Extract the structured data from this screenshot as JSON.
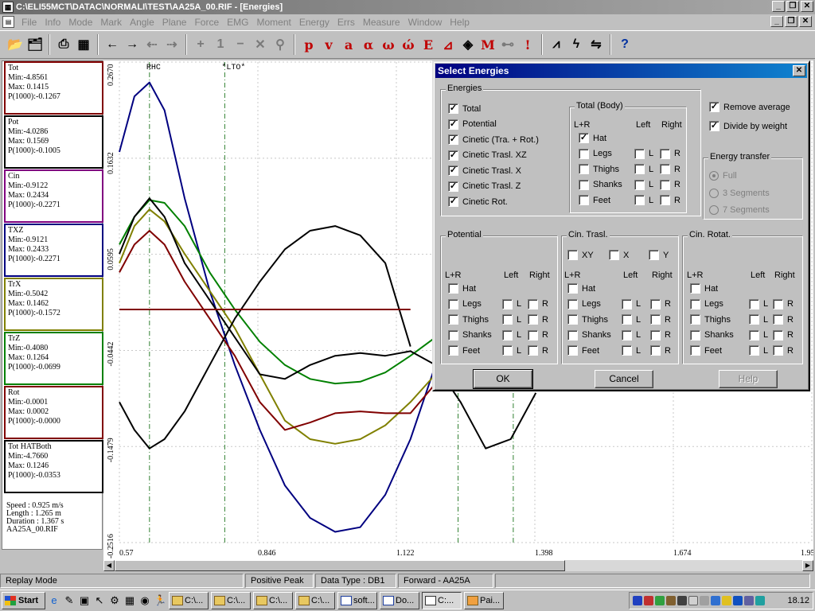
{
  "window": {
    "title": "C:\\ELI55MCT\\DATAC\\NORMALI\\TEST\\AA25A_00.RIF - [Energies]",
    "app_icon": "vicon-app-icon"
  },
  "menubar": {
    "items": [
      "File",
      "Info",
      "Mode",
      "Mark",
      "Angle",
      "Plane",
      "Force",
      "EMG",
      "Moment",
      "Energy",
      "Errs",
      "Measure",
      "Window",
      "Help"
    ]
  },
  "left_panel": {
    "boxes": [
      {
        "name": "Tot",
        "min": "Min:-4.8561",
        "max": "Max: 0.1415",
        "p": "P(1000):-0.1267",
        "color": "#800000"
      },
      {
        "name": "Pot",
        "min": "Min:-4.0286",
        "max": "Max: 0.1569",
        "p": "P(1000):-0.1005",
        "color": "#000000"
      },
      {
        "name": "Cin",
        "min": "Min:-0.9122",
        "max": "Max: 0.2434",
        "p": "P(1000):-0.2271",
        "color": "#800080"
      },
      {
        "name": "TXZ",
        "min": "Min:-0.9121",
        "max": "Max: 0.2433",
        "p": "P(1000):-0.2271",
        "color": "#000080"
      },
      {
        "name": "TrX",
        "min": "Min:-0.5042",
        "max": "Max: 0.1462",
        "p": "P(1000):-0.1572",
        "color": "#808000"
      },
      {
        "name": "TrZ",
        "min": "Min:-0.4080",
        "max": "Max: 0.1264",
        "p": "P(1000):-0.0699",
        "color": "#008000"
      },
      {
        "name": "Rot",
        "min": "Min:-0.0001",
        "max": "Max: 0.0002",
        "p": "P(1000):-0.0000",
        "color": "#800000"
      },
      {
        "name": "Tot HATBoth",
        "min": "Min:-4.7660",
        "max": "Max: 0.1246",
        "p": "P(1000):-0.0353",
        "color": "#000000"
      }
    ],
    "info": {
      "speed": "Speed : 0.925 m/s",
      "length": "Length : 1.265 m",
      "duration": "Duration : 1.367 s",
      "file": "AA25A_00.RIF"
    }
  },
  "chart_data": {
    "type": "line",
    "y_ticks": [
      "0.2670",
      "0.1632",
      "0.0595",
      "-0.0442",
      "-0.1479",
      "-0.2516"
    ],
    "x_ticks": [
      "0.57",
      "0.846",
      "1.122",
      "1.398",
      "1.674",
      "1.95"
    ],
    "xlim": [
      0.57,
      1.95
    ],
    "ylim": [
      -0.2516,
      0.267
    ],
    "events": [
      {
        "label": "RHC",
        "x": 0.63
      },
      {
        "label": "*LTO*",
        "x": 0.78
      }
    ],
    "event_lines_unlabeled": [
      1.245,
      1.355
    ],
    "series": [
      {
        "color": "#000080",
        "x": [
          0.57,
          0.6,
          0.63,
          0.66,
          0.7,
          0.75,
          0.8,
          0.85,
          0.9,
          0.95,
          1.0,
          1.05,
          1.1,
          1.15,
          1.2
        ],
        "y": [
          0.17,
          0.23,
          0.245,
          0.215,
          0.12,
          0.02,
          -0.06,
          -0.13,
          -0.19,
          -0.225,
          -0.24,
          -0.235,
          -0.2,
          -0.14,
          -0.06
        ]
      },
      {
        "color": "#008000",
        "x": [
          0.57,
          0.6,
          0.63,
          0.66,
          0.7,
          0.75,
          0.8,
          0.85,
          0.9,
          0.95,
          1.0,
          1.05,
          1.1,
          1.15,
          1.2
        ],
        "y": [
          0.07,
          0.1,
          0.118,
          0.115,
          0.09,
          0.04,
          0.0,
          -0.035,
          -0.06,
          -0.075,
          -0.08,
          -0.078,
          -0.068,
          -0.05,
          -0.03
        ]
      },
      {
        "color": "#808000",
        "x": [
          0.57,
          0.6,
          0.63,
          0.66,
          0.7,
          0.75,
          0.8,
          0.85,
          0.9,
          0.95,
          1.0,
          1.05,
          1.1,
          1.15,
          1.2
        ],
        "y": [
          0.05,
          0.09,
          0.108,
          0.095,
          0.06,
          0.02,
          -0.02,
          -0.07,
          -0.12,
          -0.14,
          -0.145,
          -0.14,
          -0.125,
          -0.1,
          -0.07
        ]
      },
      {
        "color": "#800000",
        "x": [
          0.57,
          0.6,
          0.63,
          0.66,
          0.7,
          0.75,
          0.8,
          0.85,
          0.9,
          0.95,
          1.0,
          1.05,
          1.1,
          1.15,
          1.2
        ],
        "y": [
          0.04,
          0.07,
          0.085,
          0.07,
          0.03,
          -0.01,
          -0.05,
          -0.1,
          -0.13,
          -0.122,
          -0.112,
          -0.11,
          -0.112,
          -0.112,
          -0.08
        ]
      },
      {
        "color": "#000000",
        "x": [
          0.57,
          0.6,
          0.63,
          0.66,
          0.7,
          0.75,
          0.8,
          0.85,
          0.9,
          0.95,
          1.0,
          1.05,
          1.1,
          1.15,
          1.2,
          1.25,
          1.3,
          1.35,
          1.4
        ],
        "y": [
          0.06,
          0.1,
          0.12,
          0.1,
          0.05,
          0.01,
          -0.03,
          -0.07,
          -0.075,
          -0.06,
          -0.05,
          -0.047,
          -0.05,
          -0.045,
          -0.06,
          -0.1,
          -0.15,
          -0.14,
          -0.09
        ]
      },
      {
        "color": "#000000",
        "x": [
          0.57,
          0.6,
          0.63,
          0.66,
          0.7,
          0.75,
          0.8,
          0.85,
          0.9,
          0.95,
          1.0,
          1.05,
          1.1,
          1.15
        ],
        "y": [
          -0.1,
          -0.13,
          -0.15,
          -0.14,
          -0.11,
          -0.06,
          -0.01,
          0.03,
          0.065,
          0.085,
          0.09,
          0.08,
          0.05,
          -0.04
        ]
      },
      {
        "color": "#800000",
        "x": [
          0.57,
          1.15
        ],
        "y": [
          0.0,
          0.0
        ]
      }
    ]
  },
  "status": {
    "mode": "Replay Mode",
    "peak": "Positive Peak",
    "data_type": "Data Type : DB1",
    "forward": "Forward - AA25A"
  },
  "taskbar": {
    "start": "Start",
    "tasks": [
      "C:\\...",
      "C:\\...",
      "C:\\...",
      "C:\\...",
      "soft...",
      "Do...",
      "C:...",
      "Pai..."
    ],
    "clock": "18.12"
  },
  "dialog": {
    "title": "Select Energies",
    "energies_label": "Energies",
    "energies": [
      {
        "label": "Total",
        "checked": true
      },
      {
        "label": "Potential",
        "checked": true
      },
      {
        "label": "Cinetic (Tra. + Rot.)",
        "checked": true
      },
      {
        "label": "Cinetic Trasl. XZ",
        "checked": true
      },
      {
        "label": "Cinetic Trasl. X",
        "checked": true
      },
      {
        "label": "Cinetic Trasl. Z",
        "checked": true
      },
      {
        "label": "Cinetic Rot.",
        "checked": true
      }
    ],
    "total_body_label": "Total (Body)",
    "lr": "L+R",
    "left": "Left",
    "right": "Right",
    "l": "L",
    "r": "R",
    "body_parts": [
      "Hat",
      "Legs",
      "Thighs",
      "Shanks",
      "Feet"
    ],
    "remove_average": "Remove average",
    "divide_by_weight": "Divide by weight",
    "energy_transfer_label": "Energy transfer",
    "transfer_options": [
      "Full",
      "3 Segments",
      "7 Segments"
    ],
    "potential_label": "Potential",
    "cin_trasl_label": "Cin. Trasl.",
    "cin_rotat_label": "Cin. Rotat.",
    "xyz": [
      "XY",
      "X",
      "Y"
    ],
    "ok": "OK",
    "cancel": "Cancel",
    "help": "Help",
    "check_mark": "✓"
  }
}
